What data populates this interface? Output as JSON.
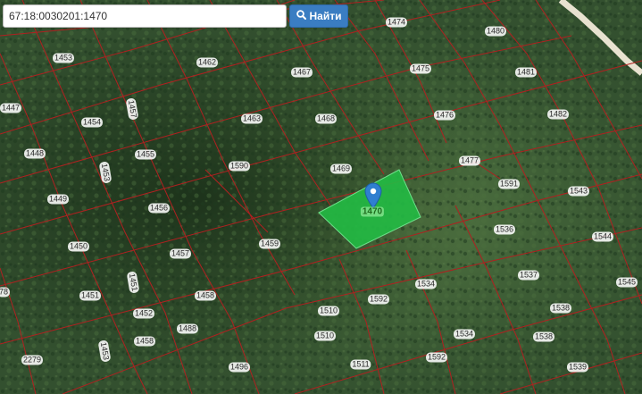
{
  "search": {
    "value": "67:18:0030201:1470",
    "button_label": "Найти",
    "button_icon": "search-icon"
  },
  "selected_parcel": {
    "label": "1470",
    "fill_color": "#22bb44"
  },
  "colors": {
    "parcel_border": "#b02020",
    "road": "#e8e2d0",
    "button": "#3a7dc2"
  },
  "parcels": [
    {
      "label": "1453"
    },
    {
      "label": "1462"
    },
    {
      "label": "1474"
    },
    {
      "label": "1480"
    },
    {
      "label": "1447"
    },
    {
      "label": "1454"
    },
    {
      "label": "1457"
    },
    {
      "label": "1467"
    },
    {
      "label": "1475"
    },
    {
      "label": "1481"
    },
    {
      "label": "1463"
    },
    {
      "label": "1468"
    },
    {
      "label": "1476"
    },
    {
      "label": "1482"
    },
    {
      "label": "1448"
    },
    {
      "label": "1455"
    },
    {
      "label": "1590"
    },
    {
      "label": "1469"
    },
    {
      "label": "1477"
    },
    {
      "label": "1453"
    },
    {
      "label": "1591"
    },
    {
      "label": "1543"
    },
    {
      "label": "1449"
    },
    {
      "label": "1456"
    },
    {
      "label": "1536"
    },
    {
      "label": "1544"
    },
    {
      "label": "1450"
    },
    {
      "label": "1457"
    },
    {
      "label": "1459"
    },
    {
      "label": "1534"
    },
    {
      "label": "1537"
    },
    {
      "label": "1545"
    },
    {
      "label": "1451"
    },
    {
      "label": "1458"
    },
    {
      "label": "1592"
    },
    {
      "label": "1510"
    },
    {
      "label": "1538"
    },
    {
      "label": "1452"
    },
    {
      "label": "1458"
    },
    {
      "label": "1510"
    },
    {
      "label": "1534"
    },
    {
      "label": "1538"
    },
    {
      "label": "2279"
    },
    {
      "label": "1496"
    },
    {
      "label": "1511"
    },
    {
      "label": "1592"
    },
    {
      "label": "1539"
    },
    {
      "label": "1451"
    },
    {
      "label": "1453"
    },
    {
      "label": "1488"
    },
    {
      "label": "78"
    }
  ]
}
